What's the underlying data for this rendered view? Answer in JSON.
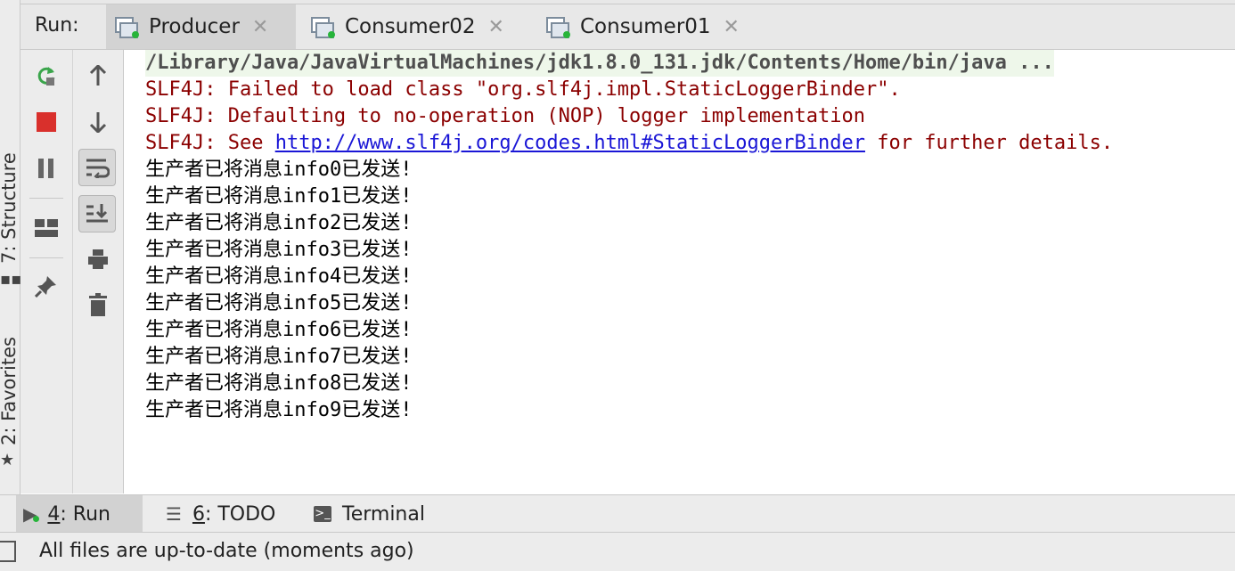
{
  "run_panel": {
    "label": "Run:",
    "tabs": [
      {
        "label": "Producer",
        "active": true
      },
      {
        "label": "Consumer02",
        "active": false
      },
      {
        "label": "Consumer01",
        "active": false
      }
    ]
  },
  "side_tabs": {
    "structure": "7: Structure",
    "favorites": "2: Favorites"
  },
  "toolbar_icons": {
    "left": [
      "rerun-icon",
      "stop-icon",
      "pause-icon",
      "layout-icon",
      "pin-icon"
    ],
    "right": [
      "up-arrow-icon",
      "down-arrow-icon",
      "soft-wrap-icon",
      "scroll-to-end-icon",
      "print-icon",
      "trash-icon"
    ]
  },
  "console": {
    "command": "/Library/Java/JavaVirtualMachines/jdk1.8.0_131.jdk/Contents/Home/bin/java ...",
    "errors": [
      "SLF4J: Failed to load class \"org.slf4j.impl.StaticLoggerBinder\".",
      "SLF4J: Defaulting to no-operation (NOP) logger implementation"
    ],
    "see_prefix": "SLF4J: See ",
    "see_link": "http://www.slf4j.org/codes.html#StaticLoggerBinder",
    "see_suffix": " for further details.",
    "output": [
      "生产者已将消息info0已发送!",
      "生产者已将消息info1已发送!",
      "生产者已将消息info2已发送!",
      "生产者已将消息info3已发送!",
      "生产者已将消息info4已发送!",
      "生产者已将消息info5已发送!",
      "生产者已将消息info6已发送!",
      "生产者已将消息info7已发送!",
      "生产者已将消息info8已发送!",
      "生产者已将消息info9已发送!"
    ]
  },
  "bottom_tabs": [
    {
      "number": "4",
      "label": ": Run",
      "active": true
    },
    {
      "number": "6",
      "label": ": TODO",
      "active": false
    },
    {
      "number": "",
      "label": "Terminal",
      "active": false
    }
  ],
  "status": {
    "message": "All files are up-to-date (moments ago)"
  },
  "colors": {
    "error_text": "#8b0000",
    "link": "#1a16d6",
    "run_green": "#27b43a",
    "stop_red": "#d9302c"
  }
}
